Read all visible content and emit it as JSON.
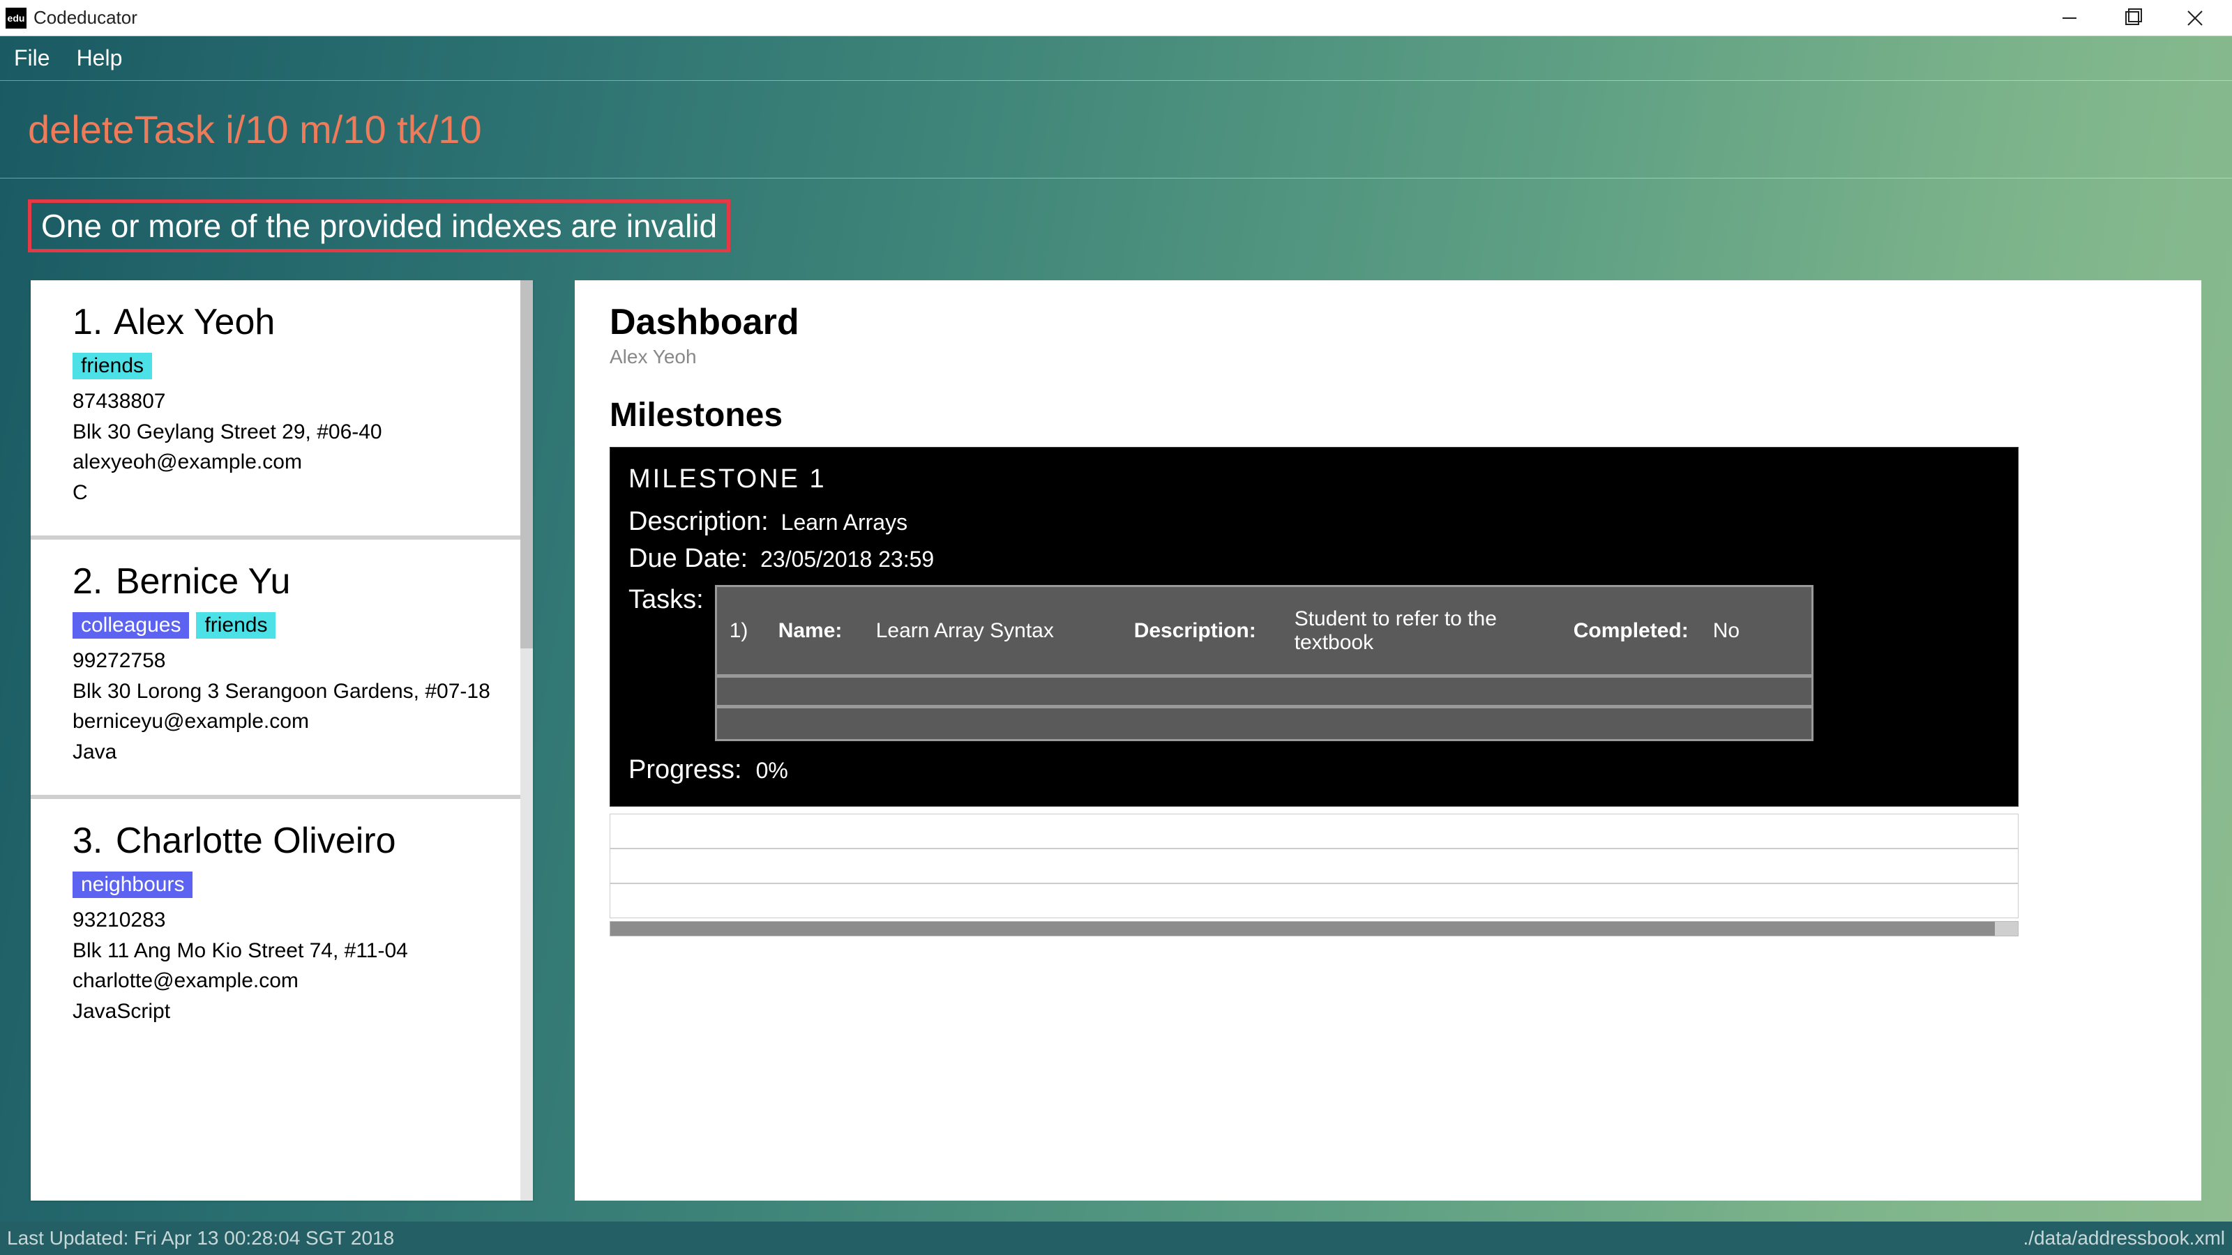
{
  "window": {
    "title": "Codeducator",
    "icon_text": "edu"
  },
  "menu": {
    "file": "File",
    "help": "Help"
  },
  "command_input": {
    "value": "deleteTask i/10 m/10 tk/10"
  },
  "error_message": "One or more of the provided indexes are invalid",
  "people": [
    {
      "index": "1.",
      "name": "Alex Yeoh",
      "tags": [
        {
          "label": "friends",
          "kind": "friends"
        }
      ],
      "phone": "87438807",
      "address": "Blk 30 Geylang Street 29, #06-40",
      "email": "alexyeoh@example.com",
      "language": "C"
    },
    {
      "index": "2.",
      "name": "Bernice Yu",
      "tags": [
        {
          "label": "colleagues",
          "kind": "colleagues"
        },
        {
          "label": "friends",
          "kind": "friends"
        }
      ],
      "phone": "99272758",
      "address": "Blk 30 Lorong 3 Serangoon Gardens, #07-18",
      "email": "berniceyu@example.com",
      "language": "Java"
    },
    {
      "index": "3.",
      "name": "Charlotte Oliveiro",
      "tags": [
        {
          "label": "neighbours",
          "kind": "neighbours"
        }
      ],
      "phone": "93210283",
      "address": "Blk 11 Ang Mo Kio Street 74, #11-04",
      "email": "charlotte@example.com",
      "language": "JavaScript"
    }
  ],
  "dashboard": {
    "title": "Dashboard",
    "subtitle": "Alex Yeoh",
    "milestones_heading": "Milestones",
    "milestone": {
      "title": "MILESTONE 1",
      "description_label": "Description:",
      "description_value": "Learn Arrays",
      "due_label": "Due Date:",
      "due_value": "23/05/2018 23:59",
      "tasks_label": "Tasks:",
      "task": {
        "index": "1)",
        "name_label": "Name:",
        "name_value": "Learn Array Syntax",
        "desc_label": "Description:",
        "desc_value": "Student to refer to the textbook",
        "completed_label": "Completed:",
        "completed_value": "No"
      },
      "progress_label": "Progress:",
      "progress_value": "0%"
    }
  },
  "status": {
    "left": "Last Updated: Fri Apr 13 00:28:04 SGT 2018",
    "right": "./data/addressbook.xml"
  }
}
